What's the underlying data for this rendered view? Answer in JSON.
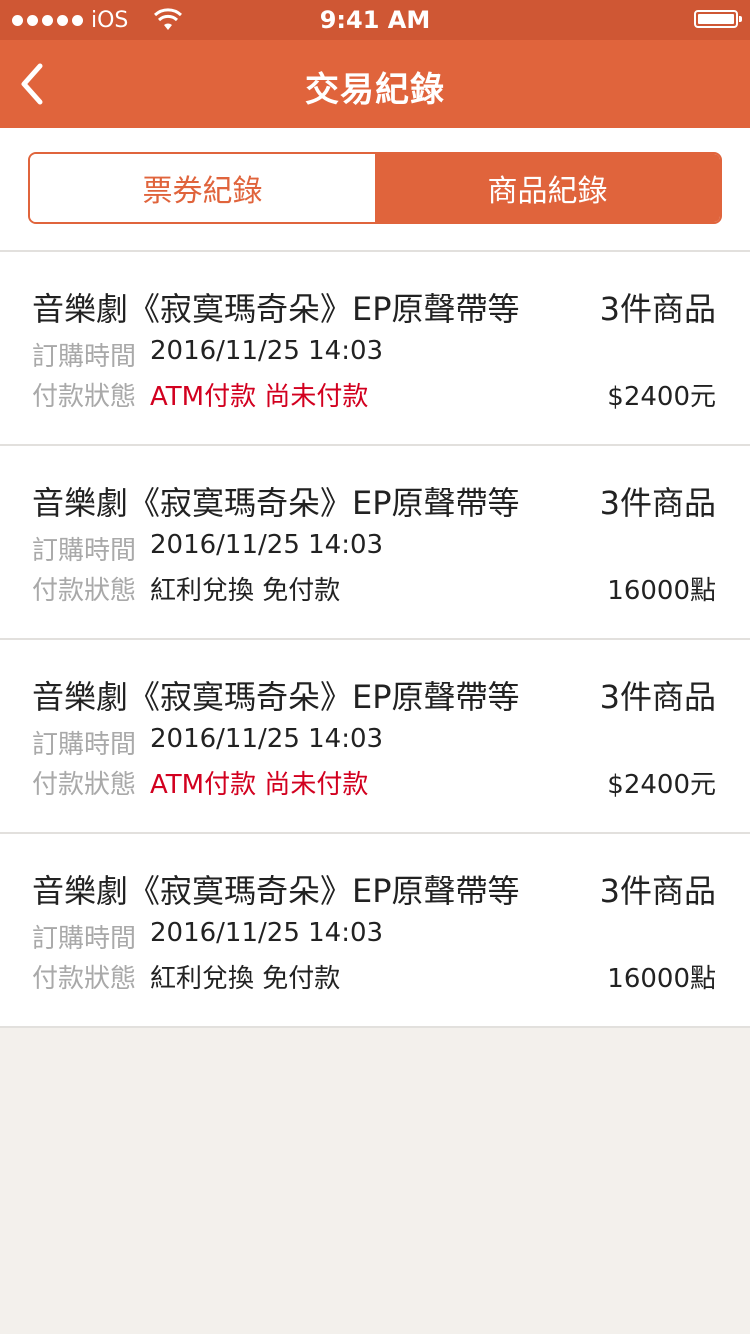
{
  "status_bar": {
    "carrier": "iOS",
    "time": "9:41 AM"
  },
  "nav": {
    "title": "交易紀錄"
  },
  "tabs": [
    {
      "label": "票券紀錄",
      "active": false
    },
    {
      "label": "商品紀錄",
      "active": true
    }
  ],
  "orders": [
    {
      "title": "音樂劇《寂寞瑪奇朵》EP原聲帶等",
      "item_count": "3件商品",
      "order_time_label": "訂購時間",
      "order_time": "2016/11/25 14:03",
      "payment_label": "付款狀態",
      "payment_status": "ATM付款 尚未付款",
      "amount": "$2400元"
    },
    {
      "title": "音樂劇《寂寞瑪奇朵》EP原聲帶等",
      "item_count": "3件商品",
      "order_time_label": "訂購時間",
      "order_time": "2016/11/25 14:03",
      "payment_label": "付款狀態",
      "payment_status": "紅利兌換 免付款",
      "amount": "16000點"
    },
    {
      "title": "音樂劇《寂寞瑪奇朵》EP原聲帶等",
      "item_count": "3件商品",
      "order_time_label": "訂購時間",
      "order_time": "2016/11/25 14:03",
      "payment_label": "付款狀態",
      "payment_status": "ATM付款 尚未付款",
      "amount": "$2400元"
    },
    {
      "title": "音樂劇《寂寞瑪奇朵》EP原聲帶等",
      "item_count": "3件商品",
      "order_time_label": "訂購時間",
      "order_time": "2016/11/25 14:03",
      "payment_label": "付款狀態",
      "payment_status": "紅利兌換 免付款",
      "amount": "16000點"
    }
  ],
  "colors": {
    "brand": "#e0643c",
    "status_bar": "#cf5734",
    "alert": "#d2001f"
  },
  "icons": {
    "back": "chevron-left-icon",
    "wifi": "wifi-icon",
    "battery": "battery-icon"
  }
}
